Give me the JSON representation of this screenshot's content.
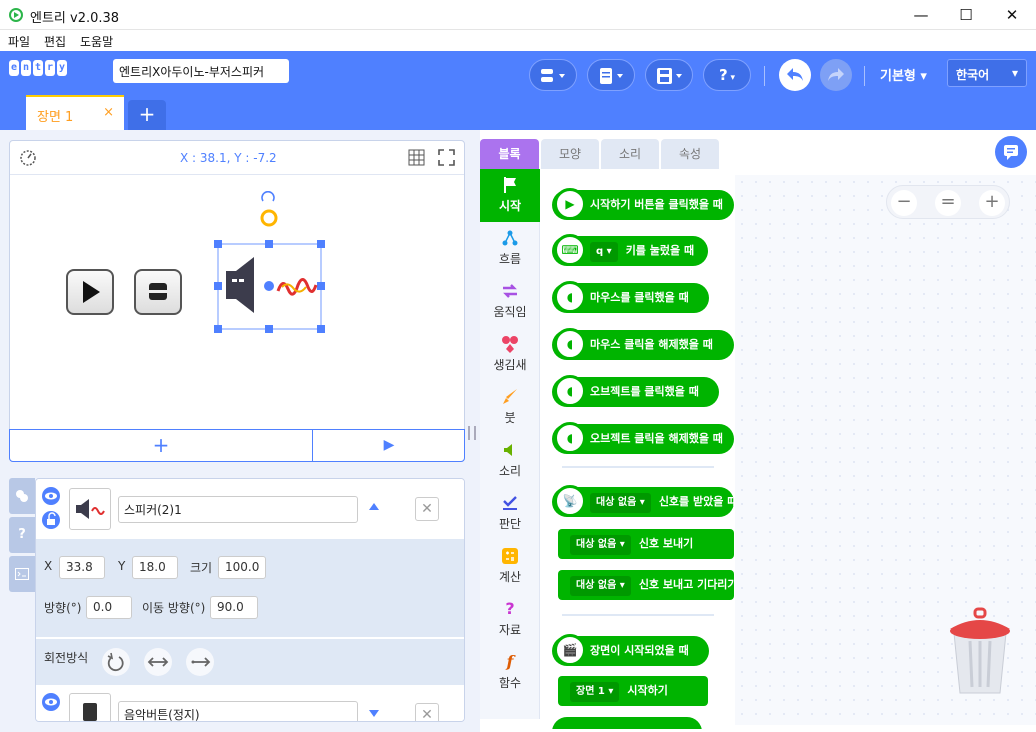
{
  "window": {
    "title": "엔트리 v2.0.38",
    "minimize": "—",
    "maximize": "☐",
    "close": "✕"
  },
  "menu": [
    "파일",
    "편집",
    "도움말"
  ],
  "header": {
    "logo_letters": [
      "e",
      "n",
      "t",
      "r",
      "y"
    ],
    "project_name": "엔트리X아두이노-부저스피커",
    "mode": "기본형 ▾",
    "language": "한국어",
    "language_caret": "▾",
    "help": "?",
    "scene_tab": "장면 1",
    "scene_tab_close": "×",
    "add_scene": "+"
  },
  "stage": {
    "coord": "X : 38.1, Y : -7.2",
    "add_object": "+",
    "play": "▶"
  },
  "object1": {
    "name": "스피커(2)1",
    "x_label": "X",
    "x_value": "33.8",
    "y_label": "Y",
    "y_value": "18.0",
    "size_label": "크기",
    "size_value": "100.0",
    "direction_label": "방향(°)",
    "direction_value": "0.0",
    "move_direction_label": "이동 방향(°)",
    "move_direction_value": "90.0",
    "rotation_label": "회전방식"
  },
  "object2": {
    "name": "음악버튼(정지)"
  },
  "tabs": [
    "블록",
    "모양",
    "소리",
    "속성"
  ],
  "categories": [
    {
      "label": "시작",
      "icon": "flag-icon"
    },
    {
      "label": "흐름",
      "icon": "flow-icon"
    },
    {
      "label": "움직임",
      "icon": "move-icon"
    },
    {
      "label": "생김새",
      "icon": "looks-icon"
    },
    {
      "label": "붓",
      "icon": "brush-icon"
    },
    {
      "label": "소리",
      "icon": "sound-icon"
    },
    {
      "label": "판단",
      "icon": "judge-icon"
    },
    {
      "label": "계산",
      "icon": "calc-icon"
    },
    {
      "label": "자료",
      "icon": "data-icon"
    },
    {
      "label": "함수",
      "icon": "function-icon"
    }
  ],
  "blocks": {
    "b1": "시작하기 버튼을 클릭했을 때",
    "b2_key": "q",
    "b2": "키를 눌렀을 때",
    "b3": "마우스를 클릭했을 때",
    "b4": "마우스 클릭을 해제했을 때",
    "b5": "오브젝트를 클릭했을 때",
    "b6": "오브젝트 클릭을 해제했을 때",
    "b7_target": "대상 없음",
    "b7": "신호를 받았을 때",
    "b8_target": "대상 없음",
    "b8": "신호 보내기",
    "b9_target": "대상 없음",
    "b9": "신호 보내고 기다리기",
    "b10": "장면이 시작되었을 때",
    "b11_target": "장면 1",
    "b11": "시작하기"
  },
  "zoom": {
    "minus": "−",
    "reset": "=",
    "plus": "+"
  },
  "colors": {
    "accent": "#4f80ff",
    "start_block": "#00b400",
    "scene_tab": "#ffcd03"
  }
}
